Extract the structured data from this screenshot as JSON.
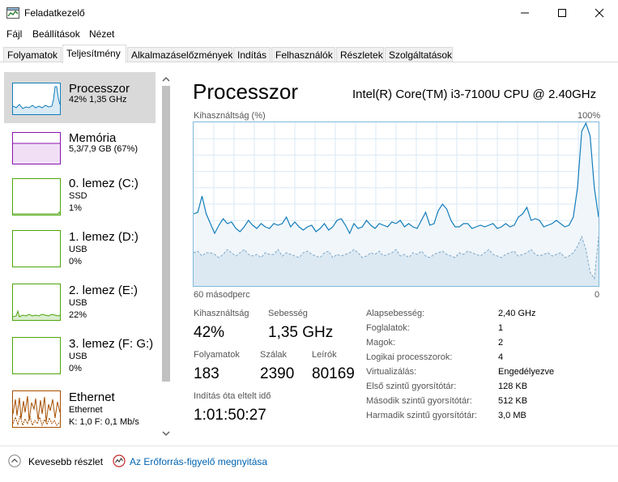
{
  "window": {
    "title": "Feladatkezelő"
  },
  "menu": [
    "Fájl",
    "Beállítások",
    "Nézet"
  ],
  "tabs": [
    {
      "label": "Folyamatok"
    },
    {
      "label": "Teljesítmény"
    },
    {
      "label": "Alkalmazáselőzmények"
    },
    {
      "label": "Indítás"
    },
    {
      "label": "Felhasználók"
    },
    {
      "label": "Részletek"
    },
    {
      "label": "Szolgáltatások"
    }
  ],
  "sidebar": {
    "items": [
      {
        "title": "Processzor",
        "line1": "42% 1,35 GHz",
        "line2": "",
        "color": "#117dbb"
      },
      {
        "title": "Memória",
        "line1": "5,3/7,9 GB (67%)",
        "line2": "",
        "color": "#8b12ae"
      },
      {
        "title": "0. lemez (C:)",
        "line1": "SSD",
        "line2": "1%",
        "color": "#4da60c"
      },
      {
        "title": "1. lemez (D:)",
        "line1": "USB",
        "line2": "0%",
        "color": "#4da60c"
      },
      {
        "title": "2. lemez (E:)",
        "line1": "USB",
        "line2": "22%",
        "color": "#4da60c"
      },
      {
        "title": "3. lemez (F: G:)",
        "line1": "USB",
        "line2": "0%",
        "color": "#4da60c"
      },
      {
        "title": "Ethernet",
        "line1": "Ethernet",
        "line2": "K: 1,0  F: 0,1 Mb/s",
        "color": "#a74f01"
      }
    ]
  },
  "main": {
    "title": "Processzor",
    "cpu_name": "Intel(R) Core(TM) i3-7100U CPU @ 2.40GHz",
    "graph": {
      "label_top_left": "Kihasználtság (%)",
      "label_top_right": "100%",
      "label_bottom_left": "60 másodperc",
      "label_bottom_right": "0"
    },
    "stats": {
      "utilization_label": "Kihasználtság",
      "utilization_value": "42%",
      "speed_label": "Sebesség",
      "speed_value": "1,35 GHz",
      "processes_label": "Folyamatok",
      "processes_value": "183",
      "threads_label": "Szálak",
      "threads_value": "2390",
      "handles_label": "Leírók",
      "handles_value": "80169",
      "uptime_label": "Indítás óta eltelt idő",
      "uptime_value": "1:01:50:27"
    },
    "specs": [
      {
        "label": "Alapsebesség:",
        "value": "2,40 GHz"
      },
      {
        "label": "Foglalatok:",
        "value": "1"
      },
      {
        "label": "Magok:",
        "value": "2"
      },
      {
        "label": "Logikai processzorok:",
        "value": "4"
      },
      {
        "label": "Virtualizálás:",
        "value": "Engedélyezve"
      },
      {
        "label": "Első szintű gyorsítótár:",
        "value": "128 KB"
      },
      {
        "label": "Második szintű gyorsítótár:",
        "value": "512 KB"
      },
      {
        "label": "Harmadik szintű gyorsítótár:",
        "value": "3,0 MB"
      }
    ]
  },
  "cpu_history": {
    "total": [
      44,
      45,
      55,
      44,
      38,
      32,
      37,
      41,
      38,
      39,
      35,
      33,
      36,
      40,
      37,
      35,
      38,
      36,
      35,
      38,
      37,
      38,
      42,
      36,
      39,
      36,
      34,
      36,
      37,
      33,
      35,
      38,
      34,
      36,
      40,
      41,
      37,
      32,
      38,
      35,
      36,
      40,
      37,
      35,
      38,
      37,
      36,
      39,
      38,
      40,
      36,
      38,
      36,
      35,
      40,
      45,
      37,
      38,
      46,
      50,
      47,
      40,
      36,
      36,
      38,
      38,
      35,
      36,
      37,
      36,
      37,
      38,
      35,
      36,
      38,
      36,
      37,
      42,
      44,
      48,
      40,
      41,
      40,
      36,
      37,
      38,
      40,
      38,
      36,
      37,
      42,
      60,
      95,
      100,
      92,
      60,
      42
    ],
    "kernel": [
      20,
      21,
      18,
      20,
      20,
      19,
      17,
      19,
      22,
      20,
      18,
      20,
      22,
      19,
      18,
      19,
      17,
      20,
      19,
      19,
      22,
      18,
      20,
      19,
      18,
      17,
      20,
      21,
      19,
      18,
      17,
      20,
      21,
      17,
      19,
      18,
      19,
      20,
      22,
      20,
      17,
      18,
      20,
      19,
      21,
      18,
      19,
      20,
      22,
      18,
      19,
      17,
      20,
      19,
      21,
      18,
      17,
      19,
      20,
      21,
      19,
      18,
      17,
      20,
      19,
      21,
      20,
      19,
      18,
      20,
      22,
      19,
      18,
      17,
      19,
      20,
      21,
      18,
      19,
      20,
      22,
      19,
      18,
      19,
      20,
      18,
      19,
      20,
      17,
      18,
      20,
      24,
      30,
      22,
      8,
      4,
      30
    ],
    "full_scale": 100
  },
  "footer": {
    "less_details": "Kevesebb részlet",
    "open_monitor": "Az Erőforrás-figyelő megnyitása"
  }
}
